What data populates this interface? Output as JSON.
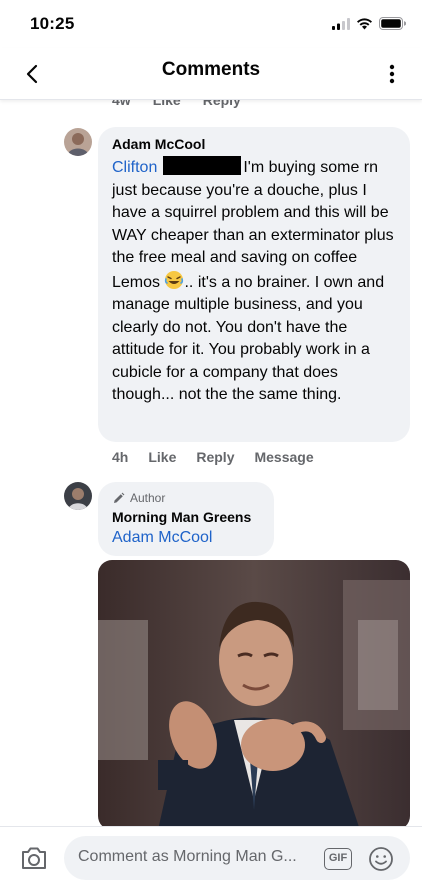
{
  "status_bar": {
    "time": "10:25"
  },
  "nav": {
    "title": "Comments"
  },
  "previous_comment_actions": {
    "time": "4w",
    "like": "Like",
    "reply": "Reply"
  },
  "comments": [
    {
      "author": "Adam McCool",
      "mention": "Clifton",
      "text": "I'm buying some rn just because you're a douche, plus I have a squirrel problem and this will be WAY cheaper than an exterminator plus the free meal and saving on coffee Lemos",
      "text_after_emoji": ".. it's a no brainer. I own and manage multiple business, and you clearly do not. You don't have the attitude for it. You probably work in a cubicle for a company that does though... not the the same thing.",
      "time": "4h",
      "like": "Like",
      "reply": "Reply",
      "message": "Message"
    },
    {
      "author_tag": "Author",
      "author": "Morning Man Greens",
      "mention": "Adam McCool"
    }
  ],
  "composer": {
    "placeholder": "Comment as Morning Man G...",
    "gif_label": "GIF"
  }
}
